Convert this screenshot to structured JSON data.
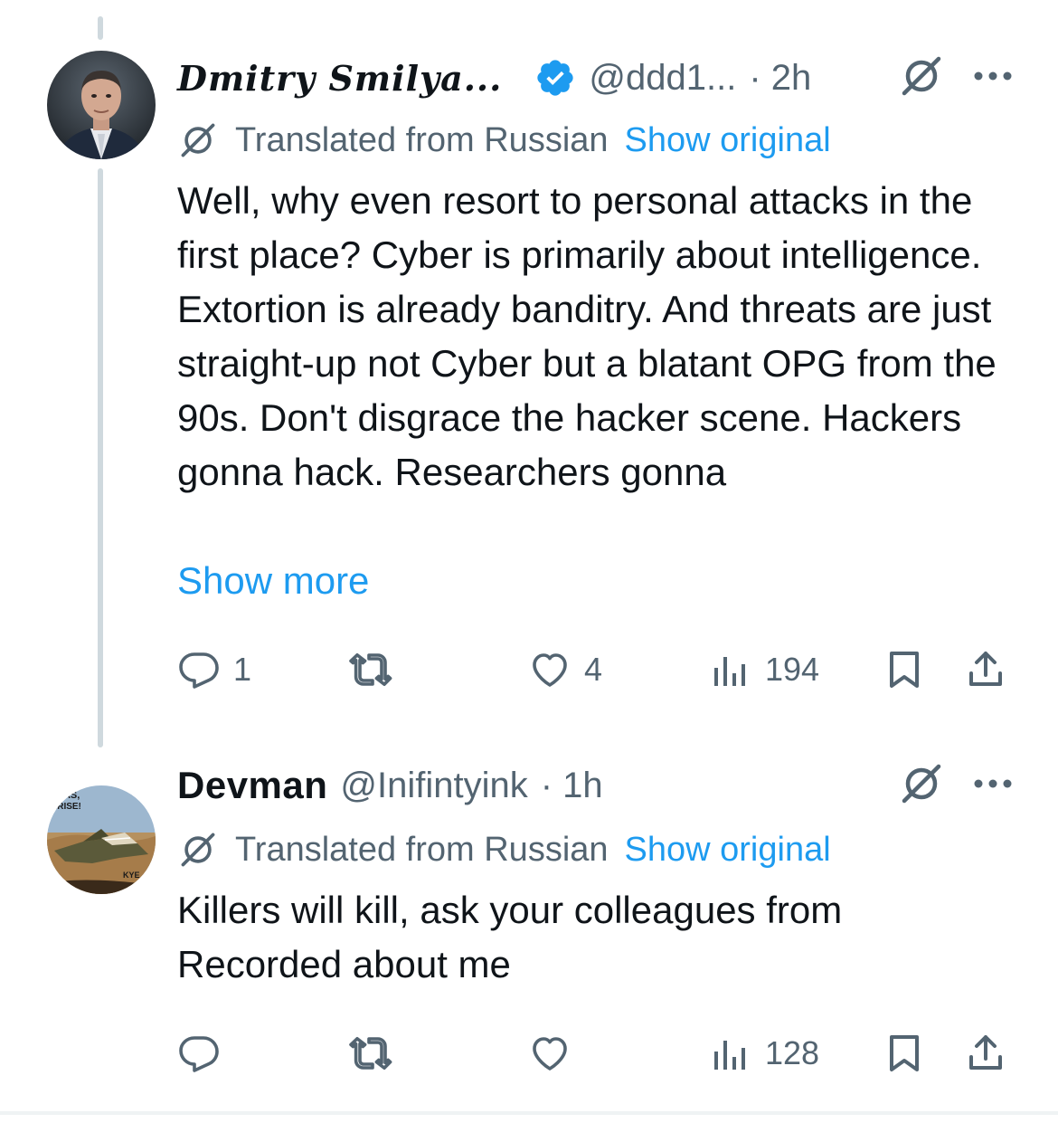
{
  "tweets": [
    {
      "display_name": "Dmitry Smilya...",
      "verified": true,
      "handle": "@ddd1...",
      "time": "· 2h",
      "translated_label": "Translated from Russian",
      "show_original": "Show original",
      "text": "Well, why even resort to personal attacks in the first place? Cyber is primarily about intelligence. Extortion is already banditry. And threats are just straight-up not Cyber but a blatant OPG from the 90s. Don't disgrace the hacker scene. Hackers gonna hack. Researchers gonna",
      "show_more": "Show more",
      "replies": "1",
      "reposts": "",
      "likes": "4",
      "views": "194"
    },
    {
      "display_name": "Devman",
      "verified": false,
      "handle": "@Inifintyink",
      "time": "· 1h",
      "translated_label": "Translated from Russian",
      "show_original": "Show original",
      "text": "Killers will kill, ask your colleagues from Recorded about me",
      "replies": "",
      "reposts": "",
      "likes": "",
      "views": "128"
    }
  ],
  "avatar_2_text": [
    "KAS,",
    "ARISE!",
    "KYE"
  ],
  "icons": {
    "verified": "verified-badge-icon",
    "grok": "grok-icon",
    "more": "more-dots-icon",
    "reply": "reply-icon",
    "repost": "repost-icon",
    "like": "heart-icon",
    "views": "views-chart-icon",
    "bookmark": "bookmark-icon",
    "share": "share-icon"
  },
  "colors": {
    "link": "#1d9bf0",
    "secondary_text": "#536471",
    "primary_text": "#0f1419",
    "thread_line": "#cfd9de"
  }
}
